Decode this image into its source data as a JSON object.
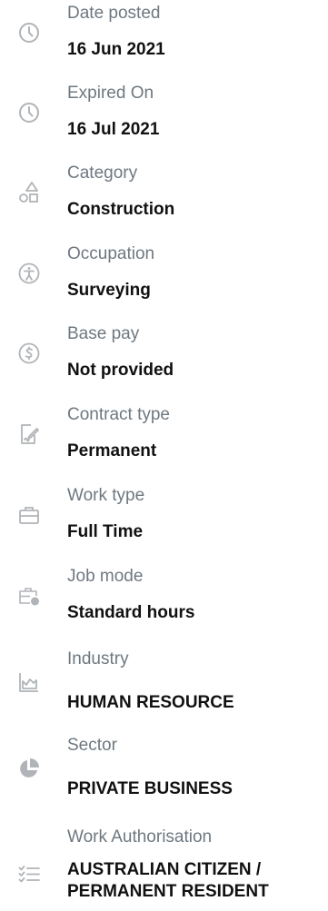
{
  "details": [
    {
      "label": "Date posted",
      "value": "16 Jun 2021",
      "icon": "clock-icon"
    },
    {
      "label": "Expired On",
      "value": "16 Jul 2021",
      "icon": "clock-icon"
    },
    {
      "label": "Category",
      "value": "Construction",
      "icon": "shapes-icon"
    },
    {
      "label": "Occupation",
      "value": "Surveying",
      "icon": "accessibility-icon"
    },
    {
      "label": "Base pay",
      "value": "Not provided",
      "icon": "dollar-circle-icon"
    },
    {
      "label": "Contract type",
      "value": "Permanent",
      "icon": "contract-sign-icon"
    },
    {
      "label": "Work type",
      "value": "Full Time",
      "icon": "briefcase-icon"
    },
    {
      "label": "Job mode",
      "value": "Standard hours",
      "icon": "briefcase-clock-icon"
    },
    {
      "label": "Industry",
      "value": "HUMAN RESOURCE",
      "icon": "area-chart-icon"
    },
    {
      "label": "Sector",
      "value": "PRIVATE BUSINESS",
      "icon": "pie-chart-icon"
    },
    {
      "label": "Work Authorisation",
      "value": "AUSTRALIAN CITIZEN / PERMANENT RESIDENT",
      "icon": "checklist-icon"
    }
  ]
}
